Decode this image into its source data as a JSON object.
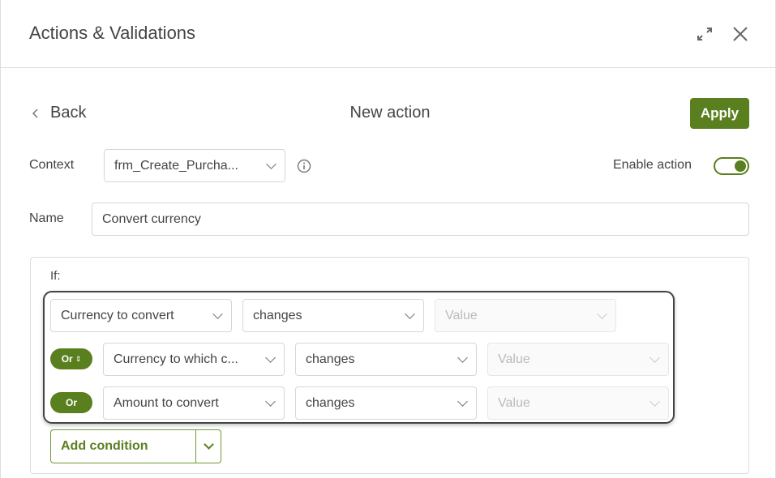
{
  "dialog": {
    "title": "Actions & Validations"
  },
  "nav": {
    "back_label": "Back",
    "page_title": "New action",
    "apply_label": "Apply"
  },
  "form": {
    "context_label": "Context",
    "context_value": "frm_Create_Purcha...",
    "enable_label": "Enable action",
    "enable_on": true,
    "name_label": "Name",
    "name_value": "Convert currency"
  },
  "conditions": {
    "if_label": "If:",
    "rows": [
      {
        "connector": "",
        "field": "Currency to convert",
        "operator": "changes",
        "value_placeholder": "Value"
      },
      {
        "connector": "Or",
        "field": "Currency to which c...",
        "operator": "changes",
        "value_placeholder": "Value"
      },
      {
        "connector": "Or",
        "field": "Amount to convert",
        "operator": "changes",
        "value_placeholder": "Value"
      }
    ],
    "add_label": "Add condition"
  },
  "colors": {
    "accent": "#5a7f1e"
  }
}
